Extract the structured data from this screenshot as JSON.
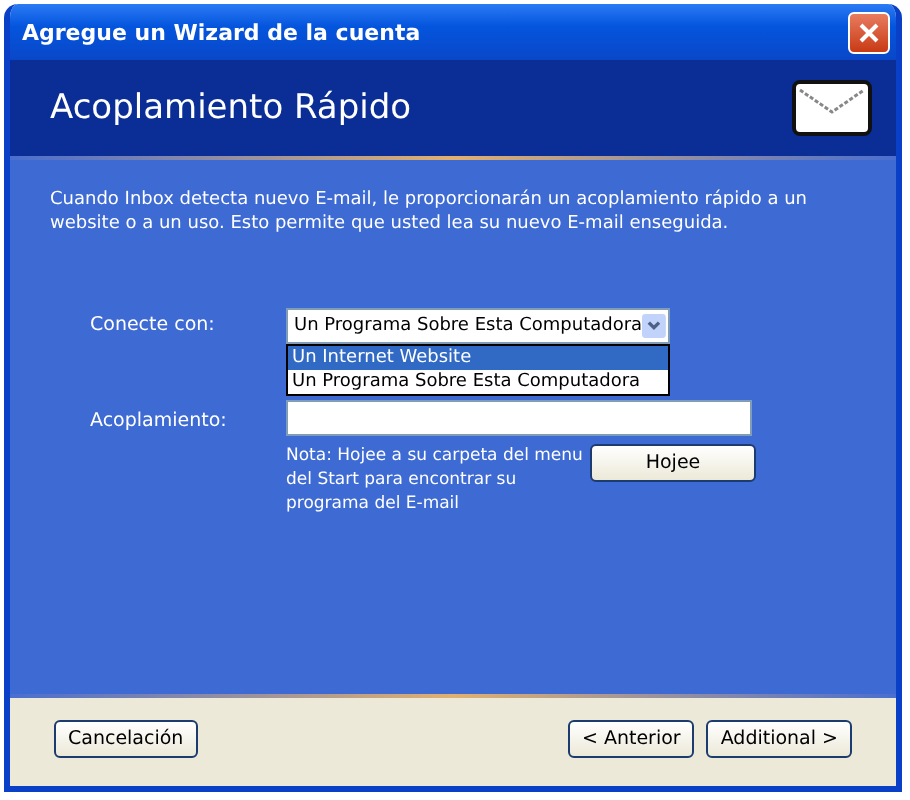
{
  "window": {
    "title": "Agregue un Wizard de la cuenta"
  },
  "header": {
    "title": "Acoplamiento Rápido"
  },
  "description": "Cuando Inbox detecta nuevo E-mail, le proporcionarán un acoplamiento rápido a un website o a un uso. Esto permite que usted lea su nuevo E-mail enseguida.",
  "connect": {
    "label": "Conecte con:",
    "value": "Un Programa Sobre Esta Computadora",
    "expanded": true,
    "options": [
      {
        "label": "Un Internet Website",
        "highlighted": true
      },
      {
        "label": "Un Programa Sobre Esta Computadora",
        "highlighted": false
      }
    ]
  },
  "shortcut": {
    "label": "Acoplamiento:",
    "note": "Nota: Hojee a su carpeta del menu del Start para encontrar su programa del E-mail",
    "browse_button": "Hojee"
  },
  "buttons": {
    "cancel": "Cancelación",
    "back": "< Anterior",
    "next": "Additional >"
  }
}
